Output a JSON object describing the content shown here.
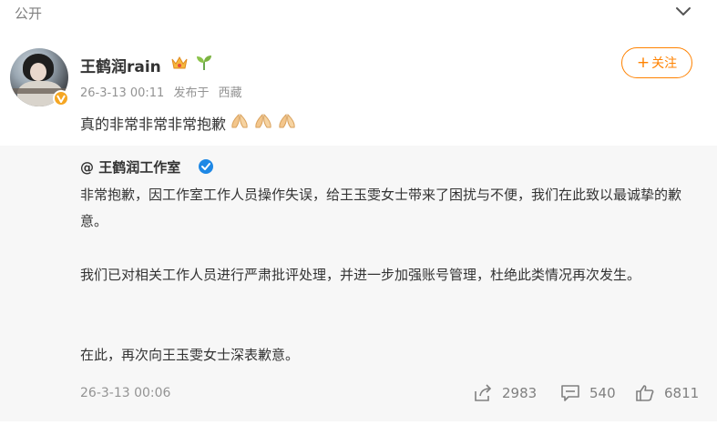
{
  "header": {
    "visibility": "公开"
  },
  "post": {
    "username": "王鹤润rain",
    "follow_label": "关注",
    "timestamp": "26-3-13 00:11",
    "location_prefix": "发布于",
    "location": "西藏",
    "text": "真的非常非常非常抱歉",
    "emojis": [
      "folded-hands",
      "folded-hands",
      "folded-hands"
    ]
  },
  "repost": {
    "author": "@ 王鹤润工作室",
    "paragraphs": [
      "非常抱歉，因工作室工作人员操作失误，给王玉雯女士带来了困扰与不便，我们在此致以最诚挚的歉意。",
      "我们已对相关工作人员进行严肃批评处理，并进一步加强账号管理，杜绝此类情况再次发生。",
      "在此，再次向王玉雯女士深表歉意。"
    ],
    "timestamp": "26-3-13 00:06",
    "stats": {
      "shares": "2983",
      "comments": "540",
      "likes": "6811"
    }
  },
  "colors": {
    "accent": "#ff8200",
    "verified_blue": "#1e88e5",
    "gold_badge": "#f5a623",
    "repost_bg": "#f7f7f7"
  }
}
